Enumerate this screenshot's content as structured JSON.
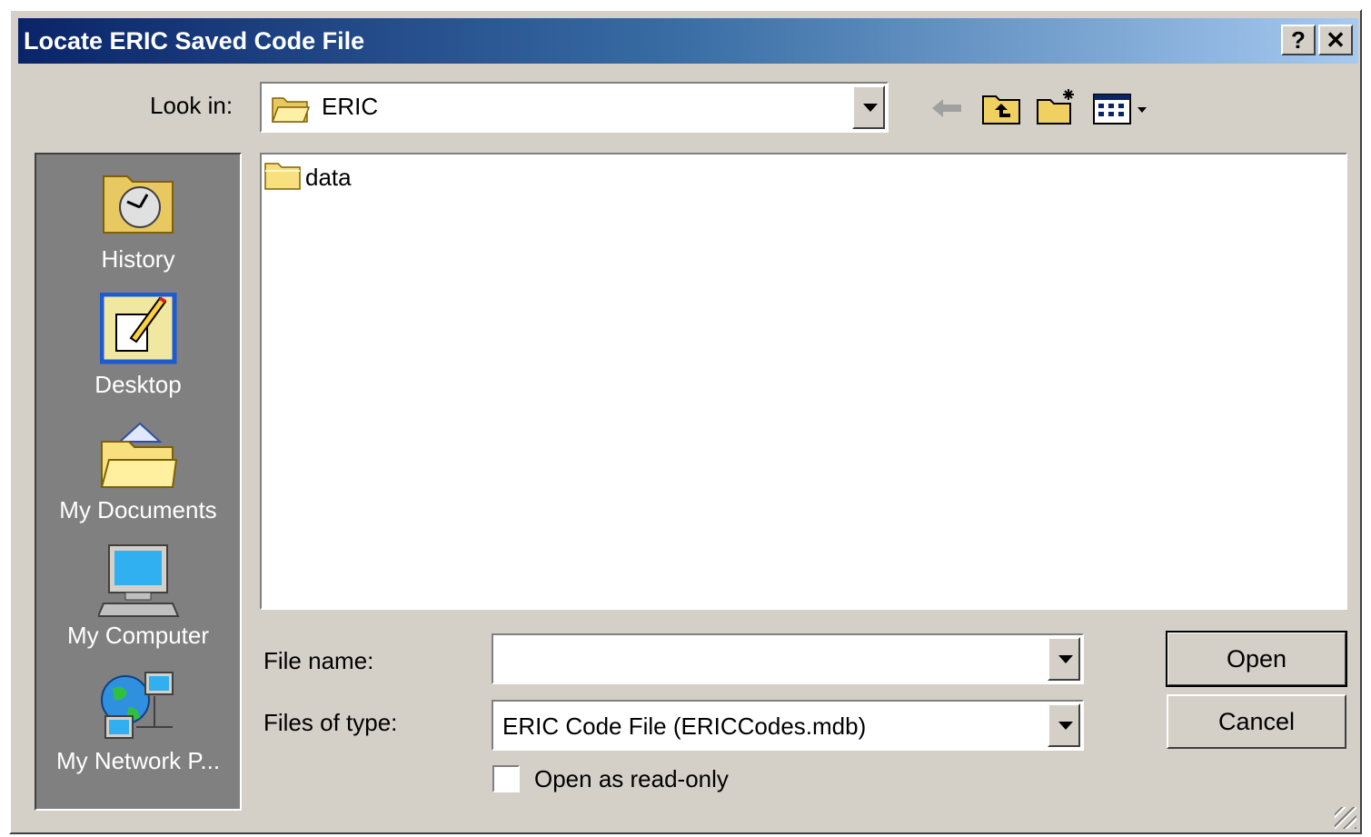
{
  "dialog": {
    "title": "Locate ERIC Saved Code File",
    "help_button": "?",
    "close_button": "✕"
  },
  "look_in": {
    "label": "Look in:",
    "value": "ERIC",
    "icon": "folder-open-icon"
  },
  "toolbar": {
    "icons": [
      "back-arrow-icon",
      "up-one-level-icon",
      "create-new-folder-icon",
      "view-menu-icon"
    ]
  },
  "places_bar": {
    "items": [
      {
        "label": "History",
        "icon": "history-icon"
      },
      {
        "label": "Desktop",
        "icon": "desktop-icon"
      },
      {
        "label": "My Documents",
        "icon": "my-documents-icon"
      },
      {
        "label": "My Computer",
        "icon": "my-computer-icon"
      },
      {
        "label": "My Network P...",
        "icon": "my-network-places-icon"
      }
    ]
  },
  "file_list": {
    "items": [
      {
        "name": "data",
        "icon": "folder-icon"
      }
    ]
  },
  "file_name": {
    "label": "File name:",
    "value": ""
  },
  "file_type": {
    "label": "Files of type:",
    "value": "ERIC Code File (ERICCodes.mdb)"
  },
  "read_only": {
    "label": "Open as read-only",
    "checked": false
  },
  "buttons": {
    "open": "Open",
    "cancel": "Cancel"
  },
  "colors": {
    "title_gradient_start": "#0a246a",
    "title_gradient_end": "#a6caf0",
    "dialog_bg": "#d4d0c8",
    "places_bg": "#808080"
  }
}
